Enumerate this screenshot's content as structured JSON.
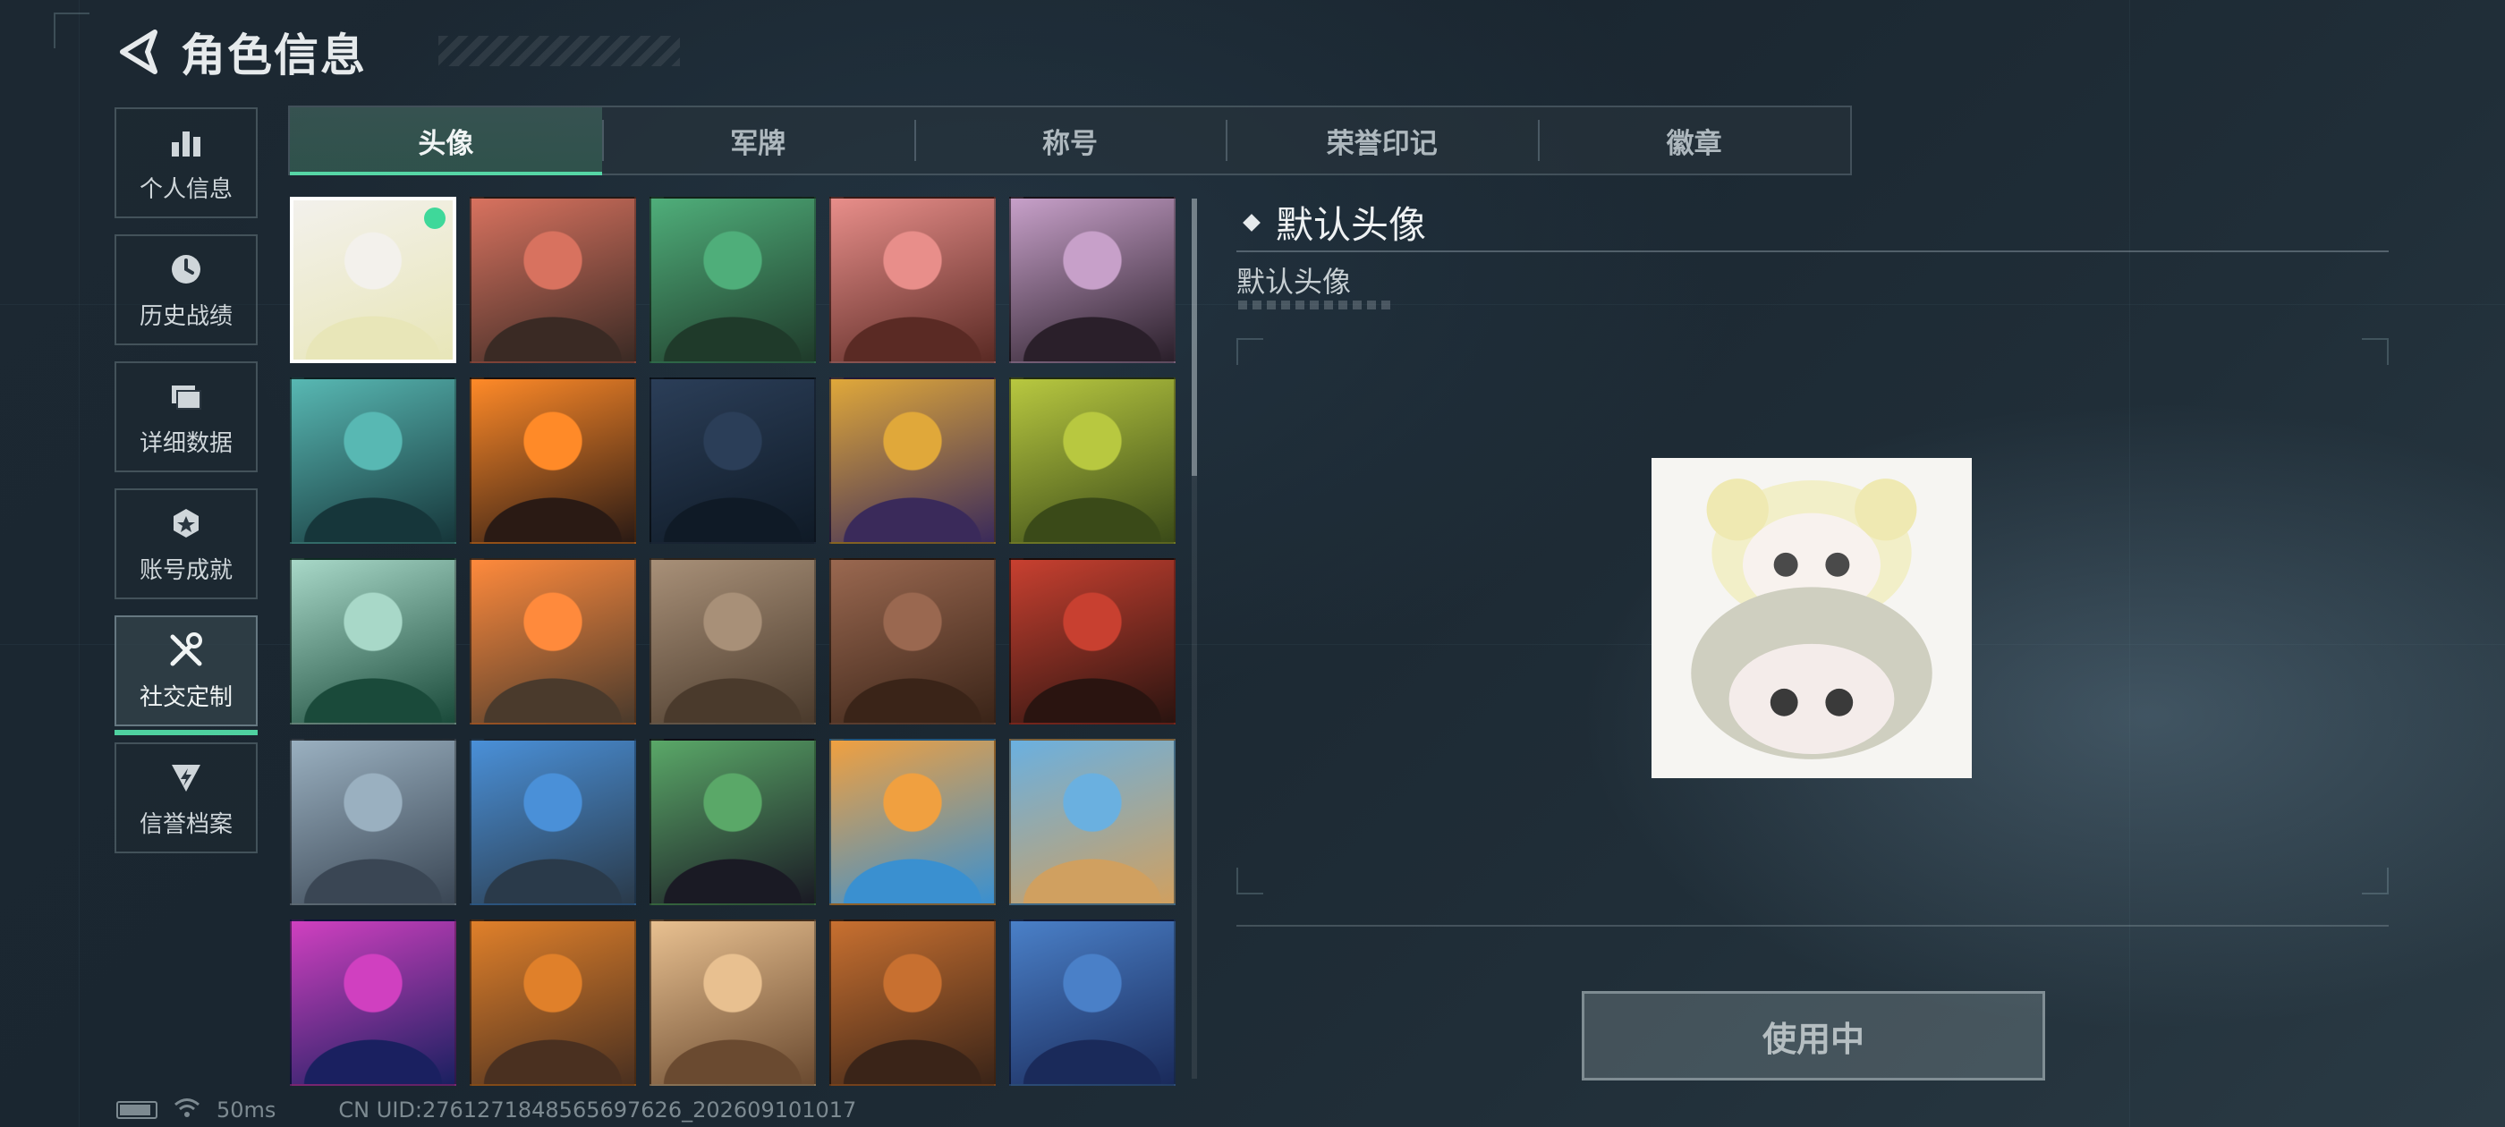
{
  "header": {
    "title": "角色信息"
  },
  "sidebar": {
    "items": [
      {
        "label": "个人信息",
        "icon": "bar-chart-icon"
      },
      {
        "label": "历史战绩",
        "icon": "history-clock-icon"
      },
      {
        "label": "详细数据",
        "icon": "folder-icon"
      },
      {
        "label": "账号成就",
        "icon": "achievement-icon"
      },
      {
        "label": "社交定制",
        "icon": "tools-icon",
        "active": true
      },
      {
        "label": "信誉档案",
        "icon": "credit-badge-icon"
      }
    ]
  },
  "tabs": [
    {
      "label": "头像",
      "active": true
    },
    {
      "label": "军牌"
    },
    {
      "label": "称号"
    },
    {
      "label": "荣誉印记"
    },
    {
      "label": "徽章"
    }
  ],
  "avatars": [
    {
      "id": "default-avatar",
      "selected": true,
      "colors": [
        "#f3f1ec",
        "#e8e6b8"
      ]
    },
    {
      "id": "soldier-cap-headset",
      "colors": [
        "#d8725f",
        "#3a2a24"
      ]
    },
    {
      "id": "soldier-green-headset",
      "colors": [
        "#4fae7a",
        "#1f3a2a"
      ]
    },
    {
      "id": "soldier-red-helmet",
      "colors": [
        "#e88e8a",
        "#5a2a24"
      ]
    },
    {
      "id": "white-hair-woman",
      "colors": [
        "#c7a0c9",
        "#2a1f2a"
      ]
    },
    {
      "id": "bearded-glasses-man",
      "colors": [
        "#58b8b3",
        "#16363a"
      ]
    },
    {
      "id": "masked-long-hair",
      "colors": [
        "#ff8a28",
        "#2a1a14"
      ]
    },
    {
      "id": "night-soldier-rifle",
      "colors": [
        "#2b3e58",
        "#0f1a26"
      ]
    },
    {
      "id": "book-cover-hand",
      "colors": [
        "#e0a83a",
        "#3a2a5a"
      ]
    },
    {
      "id": "exit-door-scene",
      "colors": [
        "#b8c840",
        "#3a4a18"
      ]
    },
    {
      "id": "way-out-sign",
      "colors": [
        "#a8d8c8",
        "#1a4a3a"
      ]
    },
    {
      "id": "orange-feather",
      "colors": [
        "#ff8a3c",
        "#4a3a2c"
      ]
    },
    {
      "id": "rusty-truck-soldier",
      "colors": [
        "#a89078",
        "#4a3a2c"
      ]
    },
    {
      "id": "justice-emblem",
      "colors": [
        "#9a6850",
        "#3a2418"
      ]
    },
    {
      "id": "red-hair-woman",
      "colors": [
        "#c84030",
        "#2a1410"
      ]
    },
    {
      "id": "mountain-peak-soldier",
      "colors": [
        "#9ab0c0",
        "#3a4654"
      ]
    },
    {
      "id": "archer-operator",
      "colors": [
        "#4a90d8",
        "#2a3a4a"
      ]
    },
    {
      "id": "green-goggle-face",
      "colors": [
        "#5aa868",
        "#1a1a24"
      ]
    },
    {
      "id": "monkey-reading",
      "colors": [
        "#f0a040",
        "#3a90d0"
      ]
    },
    {
      "id": "pyramid-glasses-man",
      "colors": [
        "#6ab0e0",
        "#d0a060"
      ]
    },
    {
      "id": "fireworks-2026",
      "colors": [
        "#d040c0",
        "#1a2060"
      ]
    },
    {
      "id": "bbq-soldier",
      "colors": [
        "#e0802a",
        "#4a3020"
      ]
    },
    {
      "id": "white-hair-cook",
      "colors": [
        "#e8c090",
        "#6a4a30"
      ]
    },
    {
      "id": "feast-group",
      "colors": [
        "#c87030",
        "#3a2418"
      ]
    },
    {
      "id": "blue-flowers",
      "colors": [
        "#4a80c8",
        "#1a2a5a"
      ]
    }
  ],
  "detail": {
    "title": "默认头像",
    "subtitle": "默认头像",
    "button_label": "使用中"
  },
  "status_bar": {
    "ping": "50ms",
    "uid": "CN UID:2761271848565697626_202609101017"
  },
  "colors": {
    "accent": "#56d6a6",
    "selected_dot": "#3fd89a"
  }
}
